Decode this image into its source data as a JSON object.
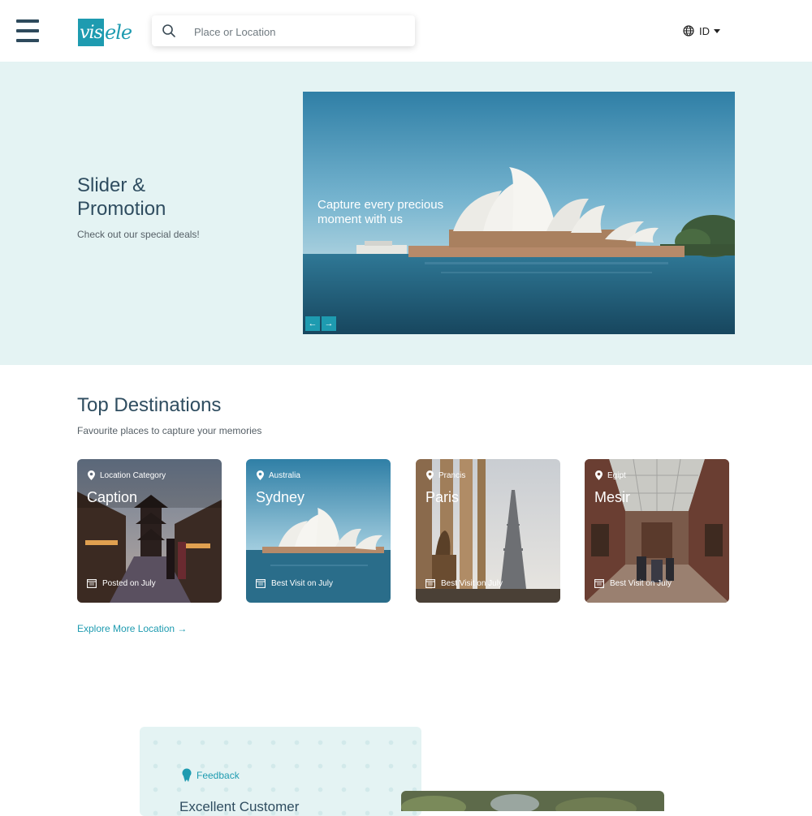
{
  "header": {
    "logo_mark": "vis",
    "logo_rest": "ele",
    "search_placeholder": "Place or Location",
    "language": "ID"
  },
  "hero": {
    "title": "Slider & Promotion",
    "subtitle": "Check out our special deals!",
    "slide_caption": "Capture every precious moment with us",
    "prev_glyph": "←",
    "next_glyph": "→"
  },
  "destinations": {
    "title": "Top Destinations",
    "subtitle": "Favourite places to capture your memories",
    "cards": [
      {
        "category": "Location Category",
        "name": "Caption",
        "footer": "Posted on July"
      },
      {
        "category": "Australia",
        "name": "Sydney",
        "footer": "Best Visit on July"
      },
      {
        "category": "Prancis",
        "name": "Paris",
        "footer": "Best Visit on July"
      },
      {
        "category": "Egipt",
        "name": "Mesir",
        "footer": "Best Visit on July"
      }
    ],
    "explore_link": "Explore More Location →"
  },
  "feedback": {
    "label": "Feedback",
    "title": "Excellent Customer"
  },
  "colors": {
    "accent": "#1e9bb0",
    "hero_bg": "#e4f3f3",
    "heading": "#2f4d60"
  }
}
